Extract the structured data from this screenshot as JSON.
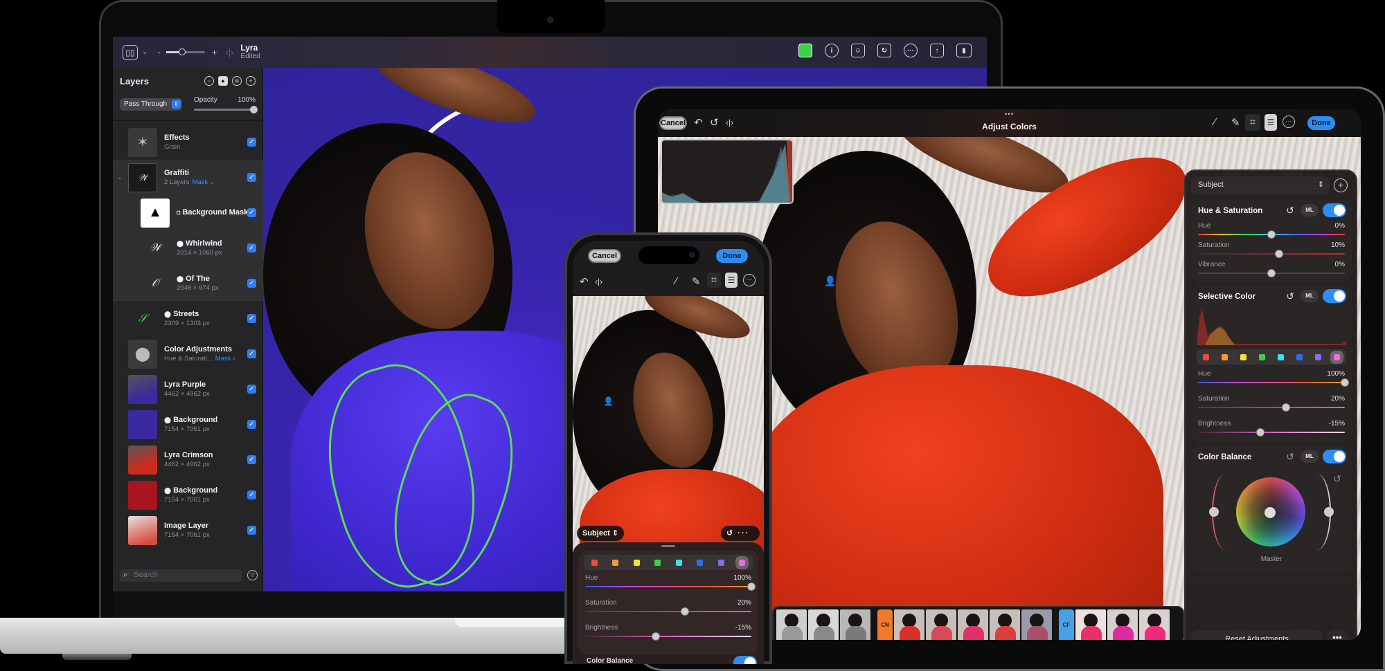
{
  "mac": {
    "toolbar": {
      "zoom_minus": "-",
      "zoom_plus": "+",
      "compare_icon": "‹|›",
      "doc_title": "Lyra",
      "doc_status": "Edited",
      "right_icons": [
        "color-swatches-icon",
        "info-icon",
        "person-detect-icon",
        "rotate-icon",
        "more-options-icon",
        "share-icon",
        "sidebar-icon"
      ]
    },
    "layers": {
      "title": "Layers",
      "blend_mode": "Pass Through",
      "opacity_label": "Opacity",
      "opacity_value": "100%",
      "opacity_fraction": 1.0,
      "search_placeholder": "Search",
      "items": [
        {
          "name": "Effects",
          "sub": "Grain",
          "mask": "",
          "glyph": "",
          "checked": true
        },
        {
          "name": "Graffiti",
          "sub": "2 Layers",
          "mask": "Mask ⌄",
          "glyph": "",
          "checked": true
        },
        {
          "name": "Background Mask",
          "sub": "",
          "mask": "",
          "glyph": "◘",
          "checked": true
        },
        {
          "name": "Whirlwind",
          "sub": "2014 × 1060 px",
          "mask": "",
          "glyph": "⬤",
          "checked": true
        },
        {
          "name": "Of The",
          "sub": "2048 × 974 px",
          "mask": "",
          "glyph": "⬤",
          "checked": true
        },
        {
          "name": "Streets",
          "sub": "2309 × 1303 px",
          "mask": "",
          "glyph": "⬤",
          "checked": true
        },
        {
          "name": "Color Adjustments",
          "sub": "Hue & Saturati...",
          "mask": "Mask ›",
          "glyph": "",
          "checked": true
        },
        {
          "name": "Lyra Purple",
          "sub": "4462 × 4962 px",
          "mask": "",
          "glyph": "",
          "checked": true
        },
        {
          "name": "Background",
          "sub": "7154 × 7061 px",
          "mask": "",
          "glyph": "⬤",
          "checked": true
        },
        {
          "name": "Lyra Crimson",
          "sub": "4462 × 4962 px",
          "mask": "",
          "glyph": "",
          "checked": true
        },
        {
          "name": "Background",
          "sub": "7154 × 7061 px",
          "mask": "",
          "glyph": "⬤",
          "checked": true
        },
        {
          "name": "Image Layer",
          "sub": "7154 × 7061 px",
          "mask": "",
          "glyph": "",
          "checked": true
        }
      ]
    }
  },
  "ipad": {
    "toolbar": {
      "cancel": "Cancel",
      "done": "Done",
      "title": "Adjust Colors",
      "grabber": "•••"
    },
    "panel": {
      "mask_select": "Subject",
      "hue_saturation": {
        "title": "Hue & Saturation",
        "ml": "ML",
        "enabled": true,
        "sliders": [
          {
            "label": "Hue",
            "value": "0%",
            "position": 0.5
          },
          {
            "label": "Saturation",
            "value": "10%",
            "position": 0.55
          },
          {
            "label": "Vibrance",
            "value": "0%",
            "position": 0.5
          }
        ]
      },
      "selective_color": {
        "title": "Selective Color",
        "ml": "ML",
        "enabled": true,
        "swatches": [
          "#f04a3a",
          "#f59a3a",
          "#f2e23a",
          "#3ad04a",
          "#3ae0ea",
          "#2a6ef0",
          "#8a6af0",
          "#f06ae8"
        ],
        "selected_swatch": 7,
        "sliders": [
          {
            "label": "Hue",
            "value": "100%",
            "position": 1.0
          },
          {
            "label": "Saturation",
            "value": "20%",
            "position": 0.6
          },
          {
            "label": "Brightness",
            "value": "-15%",
            "position": 0.425
          }
        ]
      },
      "color_balance": {
        "title": "Color Balance",
        "ml": "ML",
        "enabled": true,
        "wheel_label": "Master"
      },
      "reset_label": "Reset Adjustments",
      "more_label": "•••"
    },
    "filmstrip": {
      "groups": [
        {
          "tag": "",
          "tag_color": "",
          "frames": [
            "#9a9a9a",
            "#8a8a8a",
            "#7a7a7a"
          ]
        },
        {
          "tag": "CN",
          "tag_color": "#f07a2a",
          "frames": [
            "#d8302a",
            "#d84a5a",
            "#e0306a",
            "#d84040",
            "#a8506a"
          ]
        },
        {
          "tag": "CF",
          "tag_color": "#4aa0e8",
          "frames": [
            "#e8306a",
            "#e02aa0",
            "#f02a7a"
          ]
        }
      ]
    }
  },
  "iphone": {
    "cancel": "Cancel",
    "done": "Done",
    "mask_select": "Subject",
    "swatches": [
      "#f04a3a",
      "#f59a3a",
      "#f2e23a",
      "#3ad04a",
      "#3ae0ea",
      "#2a6ef0",
      "#8a6af0",
      "#f06ae8"
    ],
    "selected_swatch": 7,
    "sliders": [
      {
        "label": "Hue",
        "value": "100%",
        "position": 1.0
      },
      {
        "label": "Saturation",
        "value": "20%",
        "position": 0.6
      },
      {
        "label": "Brightness",
        "value": "-15%",
        "position": 0.425
      }
    ],
    "next_section_partial": "Color Balance"
  },
  "colors": {
    "accent_blue": "#2e8cf5",
    "mask_link_blue": "#3b8cf5"
  }
}
